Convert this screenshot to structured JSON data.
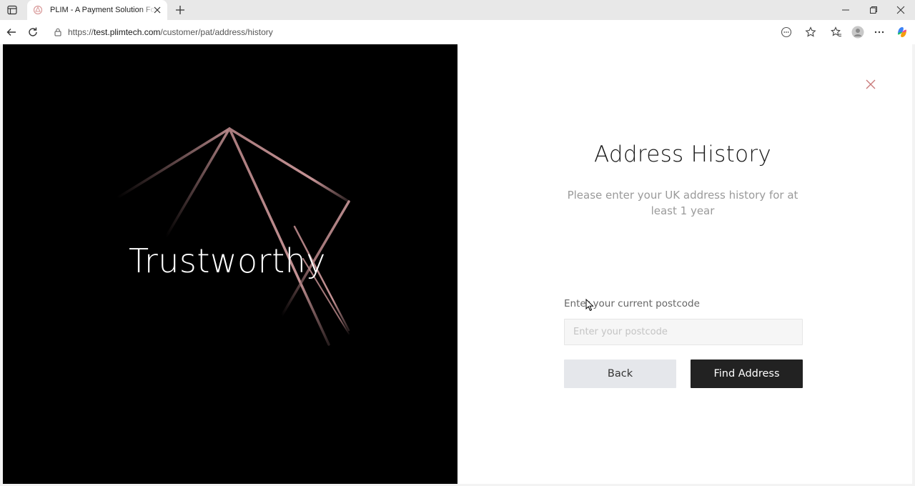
{
  "browser": {
    "tab": {
      "title": "PLIM - A Payment Solution For Th"
    },
    "url": {
      "prefix": "https://",
      "host": "test.plimtech.com",
      "path": "/customer/pat/address/history"
    },
    "accent_color": "#c97b7b"
  },
  "hero": {
    "word": "Trustworthy",
    "background": "#000000",
    "line_color": "#b07e80"
  },
  "panel": {
    "title": "Address History",
    "subtitle": "Please enter your UK address history for at least 1 year",
    "postcode": {
      "label": "Enter your current postcode",
      "placeholder": "Enter your postcode",
      "value": ""
    },
    "back_label": "Back",
    "find_label": "Find Address",
    "close_icon": "close-icon"
  }
}
